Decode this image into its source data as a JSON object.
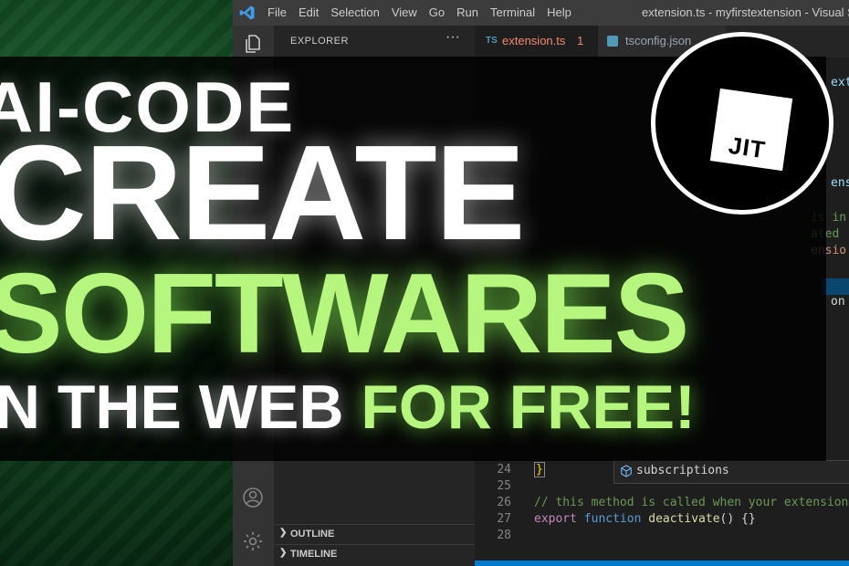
{
  "window": {
    "title": "extension.ts - myfirstextension - Visual Studi",
    "menu": [
      "File",
      "Edit",
      "Selection",
      "View",
      "Go",
      "Run",
      "Terminal",
      "Help"
    ]
  },
  "sidebar": {
    "header": "EXPLORER",
    "more": "···",
    "panels": [
      "OUTLINE",
      "TIMELINE"
    ]
  },
  "tabs": [
    {
      "badge": "TS",
      "label": "extension.ts",
      "modified": "1"
    },
    {
      "label": "tsconfig.json"
    }
  ],
  "editor": {
    "fragments": [
      "ext",
      "ens",
      "is in",
      "ated",
      "ensio",
      "on"
    ],
    "suggestion": "subscriptions",
    "lines": [
      {
        "n": "24",
        "text": "}"
      },
      {
        "n": "25",
        "text": ""
      },
      {
        "n": "26",
        "text": "// this method is called when your extension is"
      },
      {
        "n": "27",
        "kw": "export",
        "kw2": "function",
        "fn": "deactivate",
        "rest": "() {}"
      },
      {
        "n": "28",
        "text": ""
      }
    ]
  },
  "overlay": {
    "line1": "AI-CODE",
    "line2": "CREATE",
    "line3": "SOFTWARES",
    "line4_white": "IN THE WEB",
    "line4_green": "FOR FREE!"
  },
  "logo": {
    "text": "JIT"
  },
  "colors": {
    "accent_green": "#b6f57e",
    "vscode_blue": "#007acc"
  }
}
